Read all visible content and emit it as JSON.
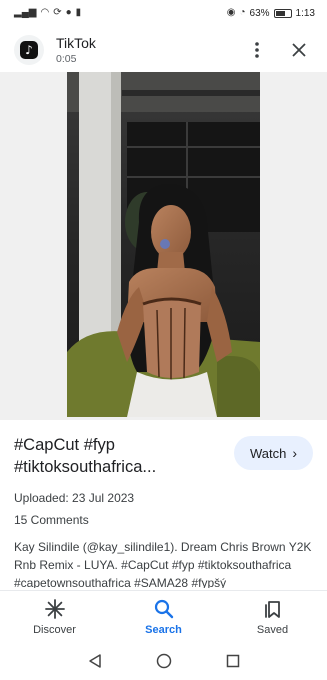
{
  "status_bar": {
    "battery": "63%",
    "time": "1:13"
  },
  "header": {
    "app_name": "TikTok",
    "duration": "0:05",
    "logo_glyph": "♪"
  },
  "video": {
    "title": "#CapCut #fyp #tiktoksouthafrica...",
    "watch_label": "Watch",
    "uploaded": "Uploaded: 23 Jul 2023",
    "comments": "15 Comments",
    "description": "Kay Silindile (@kay_silindile1). Dream Chris Brown Y2K Rnb Remix - LUYA. #CapCut #fyp #tiktoksouthafrica #capetownsouthafrica #SAMA28 #fypšý"
  },
  "bottom_nav": {
    "items": [
      {
        "label": "Discover",
        "icon": "asterisk-icon",
        "active": false
      },
      {
        "label": "Search",
        "icon": "search-icon",
        "active": true
      },
      {
        "label": "Saved",
        "icon": "bookmark-icon",
        "active": false
      }
    ]
  },
  "colors": {
    "accent": "#1a73e8",
    "watch_bg": "#e8f0fe",
    "text": "#202124"
  }
}
